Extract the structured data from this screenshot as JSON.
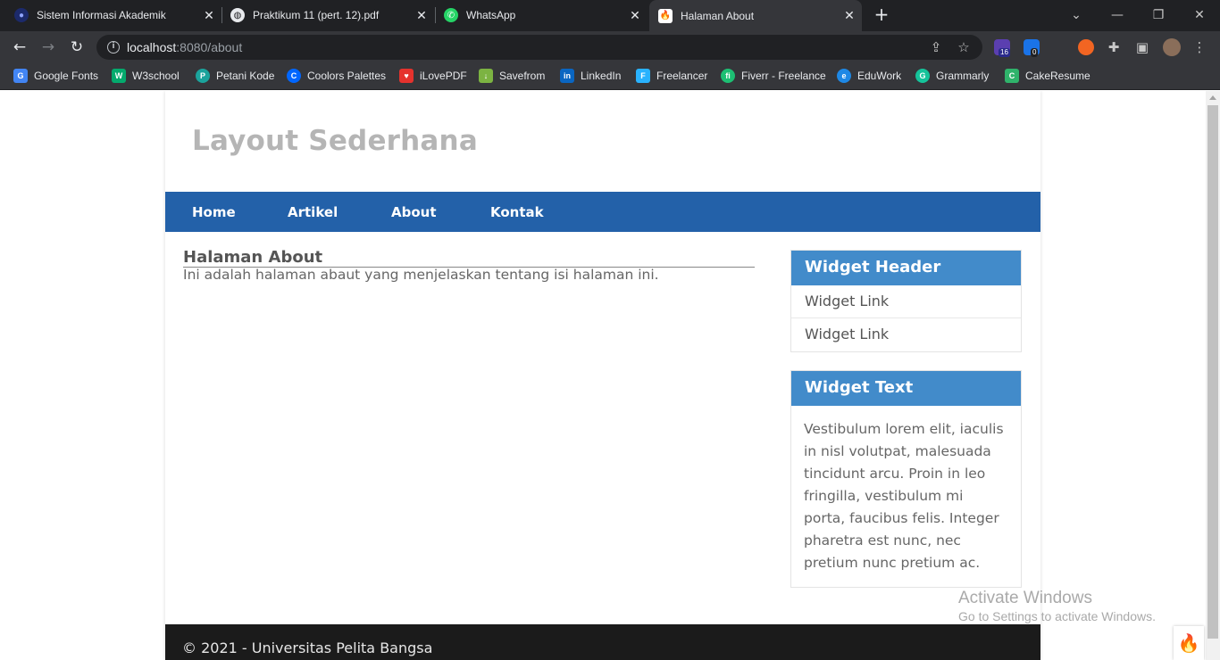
{
  "browser": {
    "tabs": [
      {
        "title": "Sistem Informasi Akademik",
        "active": false,
        "icon": "university-icon"
      },
      {
        "title": "Praktikum 11 (pert. 12).pdf",
        "active": false,
        "icon": "globe-icon"
      },
      {
        "title": "WhatsApp",
        "active": false,
        "icon": "whatsapp-icon"
      },
      {
        "title": "Halaman About",
        "active": true,
        "icon": "codeigniter-flame-icon"
      }
    ],
    "close_glyph": "✕",
    "new_tab_glyph": "+",
    "address": {
      "host": "localhost",
      "rest": ":8080/about"
    },
    "extension_badges": {
      "badge1": "16",
      "badge2": "0"
    },
    "bookmarks": [
      {
        "label": "Google Fonts",
        "color": "#4285f4"
      },
      {
        "label": "W3school",
        "color": "#04aa6d"
      },
      {
        "label": "Petani Kode",
        "color": "#1ba39c"
      },
      {
        "label": "Coolors Palettes",
        "color": "#0066ff"
      },
      {
        "label": "iLovePDF",
        "color": "#e5322d"
      },
      {
        "label": "Savefrom",
        "color": "#7cb342"
      },
      {
        "label": "LinkedIn",
        "color": "#0a66c2"
      },
      {
        "label": "Freelancer",
        "color": "#29b2fe"
      },
      {
        "label": "Fiverr - Freelance",
        "color": "#1dbf73"
      },
      {
        "label": "EduWork",
        "color": "#1e88e5"
      },
      {
        "label": "Grammarly",
        "color": "#15c39a"
      },
      {
        "label": "CakeResume",
        "color": "#2fb36b"
      }
    ]
  },
  "page": {
    "site_title": "Layout Sederhana",
    "nav": [
      "Home",
      "Artikel",
      "About",
      "Kontak"
    ],
    "heading": "Halaman About",
    "body_text": "Ini adalah halaman abaut yang menjelaskan tentang isi halaman ini.",
    "widget1": {
      "header": "Widget Header",
      "links": [
        "Widget Link",
        "Widget Link"
      ]
    },
    "widget2": {
      "header": "Widget Text",
      "text": "Vestibulum lorem elit, iaculis in nisl volutpat, malesuada tincidunt arcu. Proin in leo fringilla, vestibulum mi porta, faucibus felis. Integer pharetra est nunc, nec pretium nunc pretium ac."
    },
    "footer": "© 2021 - Universitas Pelita Bangsa"
  },
  "overlay": {
    "activate_title": "Activate Windows",
    "activate_sub": "Go to Settings to activate Windows."
  },
  "colors": {
    "nav_bg": "#2361a9",
    "widget_header": "#428bca",
    "footer_bg": "#1b1b1b",
    "title_gray": "#b5b5b5"
  }
}
